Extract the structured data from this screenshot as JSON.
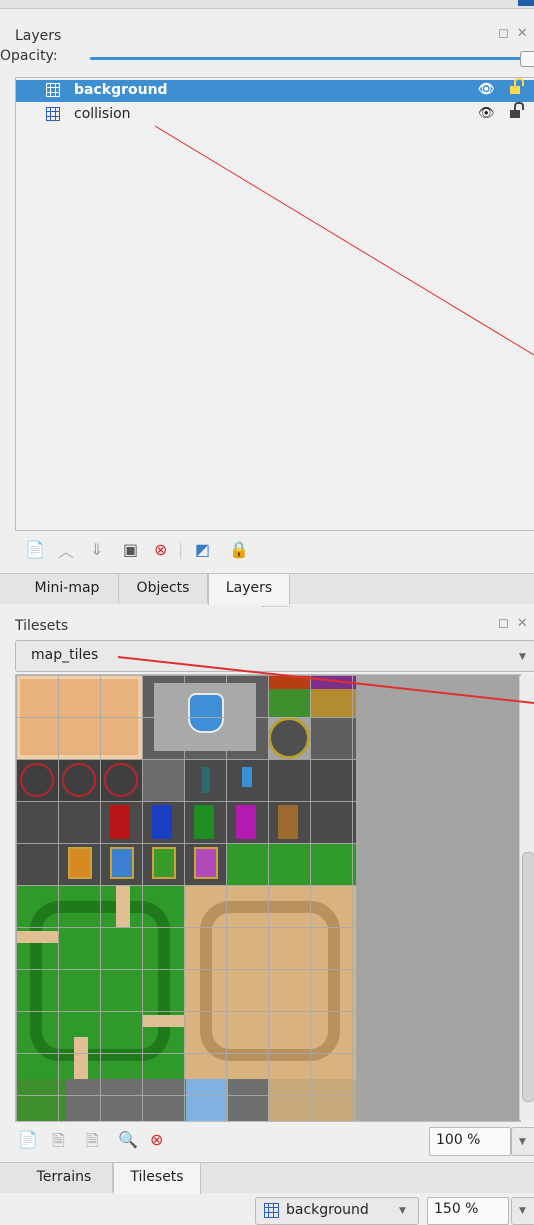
{
  "layers_panel": {
    "title": "Layers",
    "opacity_label": "Opacity:",
    "opacity": 1.0,
    "layers": [
      {
        "name": "background",
        "visible_icon": "eye-icon",
        "lock_icon": "lock-open-icon",
        "selected": true
      },
      {
        "name": "collision",
        "visible_icon": "eye-icon",
        "lock_icon": "lock-open-icon",
        "selected": false
      }
    ],
    "toolbar": [
      "new-layer-icon",
      "raise-layer-icon",
      "lower-layer-icon",
      "duplicate-layer-icon",
      "delete-layer-icon",
      "merge-layer-icon",
      "lock-icon"
    ]
  },
  "tabs_top": [
    "Mini-map",
    "Objects",
    "Layers"
  ],
  "tabs_top_active": "Layers",
  "tilesets_panel": {
    "title": "Tilesets",
    "selected_tileset": "map_tiles",
    "zoom": "100 %",
    "toolbar": [
      "new-tileset-icon",
      "import-tileset-icon",
      "export-tileset-icon",
      "edit-tileset-icon",
      "delete-tileset-icon"
    ]
  },
  "tabs_bottom": [
    "Terrains",
    "Tilesets"
  ],
  "tabs_bottom_active": "Tilesets",
  "status_bar": {
    "layer": "background",
    "zoom": "150 %"
  },
  "colors": {
    "selection": "#3d8fd1",
    "annotation_line": "#e03030"
  }
}
